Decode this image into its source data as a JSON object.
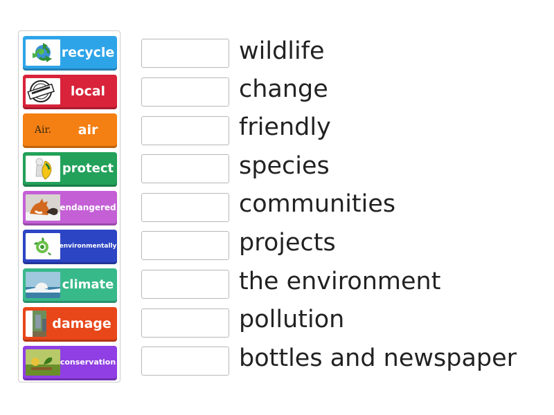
{
  "tiles": [
    {
      "label": "recycle",
      "color": "#2ea4e8",
      "icon": "recycle-icon"
    },
    {
      "label": "local",
      "color": "#d8233a",
      "icon": "support-local-stamp-icon"
    },
    {
      "label": "air",
      "color": "#f47f12",
      "icon": "air-text-icon",
      "icon_text": "Air."
    },
    {
      "label": "protect",
      "color": "#23a15a",
      "icon": "shield-figure-icon"
    },
    {
      "label": "endangered",
      "color": "#c45fd6",
      "icon": "fox-photo-icon"
    },
    {
      "label": "environmentally",
      "color": "#2c45c4",
      "icon": "eco-globe-icon"
    },
    {
      "label": "climate",
      "color": "#38b98a",
      "icon": "polar-bear-photo-icon"
    },
    {
      "label": "damage",
      "color": "#e8471a",
      "icon": "waste-photo-icon"
    },
    {
      "label": "conservation",
      "color": "#8f3fe3",
      "icon": "nature-photo-icon"
    }
  ],
  "targets": [
    "wildlife",
    "change",
    "friendly",
    "species",
    "communities",
    "projects",
    "the environment",
    "pollution",
    "bottles and newspaper"
  ]
}
